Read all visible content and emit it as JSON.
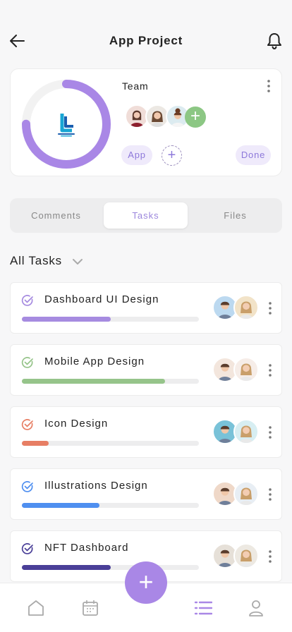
{
  "header": {
    "title": "App Project"
  },
  "project": {
    "team_label": "Team",
    "tags": {
      "app": "App",
      "done": "Done"
    },
    "progress": 0.75
  },
  "tabs": [
    {
      "label": "Comments",
      "active": false
    },
    {
      "label": "Tasks",
      "active": true
    },
    {
      "label": "Files",
      "active": false
    }
  ],
  "tasks_filter": {
    "label": "All Tasks"
  },
  "tasks": [
    {
      "name": "Dashboard UI Design",
      "progress": 0.5,
      "color": "#a68be0"
    },
    {
      "name": "Mobile App Design",
      "progress": 0.81,
      "color": "#96c48a"
    },
    {
      "name": "Icon Design",
      "progress": 0.15,
      "color": "#e77e64"
    },
    {
      "name": "Illustrations Design",
      "progress": 0.44,
      "color": "#4f8ff0"
    },
    {
      "name": "NFT Dashboard",
      "progress": 0.5,
      "color": "#4a3f98"
    }
  ],
  "colors": {
    "accent": "#a987e6",
    "add_member": "#8cc784",
    "tag_bg": "#efeafb",
    "tag_text": "#8d78da"
  },
  "icons": {
    "back": "arrow-left-icon",
    "bell": "bell-icon",
    "more": "more-vertical-icon",
    "add": "plus-icon",
    "dropdown": "chevron-down-icon",
    "nav": [
      "home-icon",
      "calendar-icon",
      "list-icon",
      "user-icon"
    ]
  }
}
